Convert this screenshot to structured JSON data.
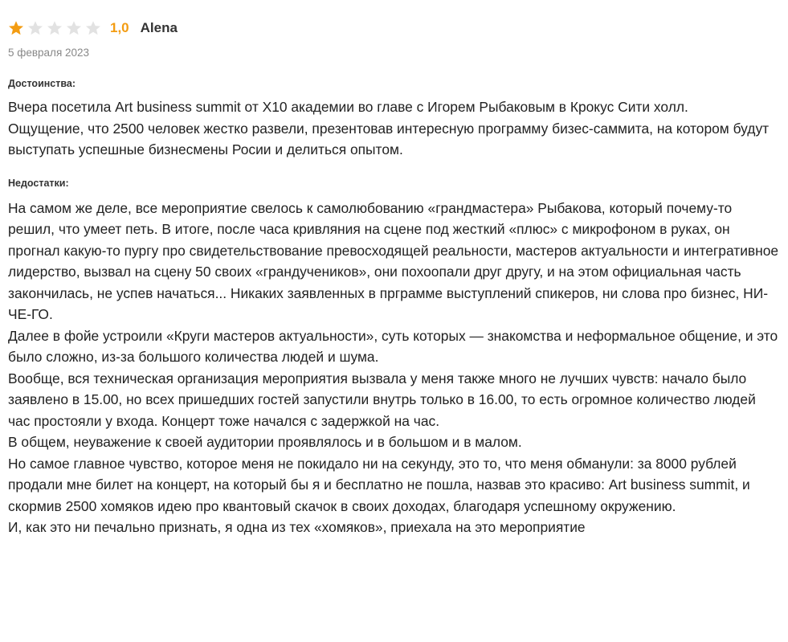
{
  "review": {
    "rating": {
      "value_label": "1,0",
      "filled_stars": 1,
      "total_stars": 5,
      "colors": {
        "filled": "#f39c12",
        "empty": "#e2e2e2"
      }
    },
    "author": "Alena",
    "date": "5 февраля 2023",
    "pros": {
      "title": "Достоинства:",
      "text": "Вчера посетила Art business summit от X10 академии во главе с Игорем Рыбаковым в Крокус Сити холл.\nОщущение, что 2500 человек жестко развели, презентовав интересную программу бизес-саммита, на котором будут выступать успешные бизнесмены Росии и делиться опытом."
    },
    "cons": {
      "title": "Недостатки:",
      "text": "На самом же деле, все мероприятие свелось к самолюбованию «грандмастера» Рыбакова, который почему-то решил, что умеет петь. В итоге, после часа кривляния на сцене под жесткий «плюс» с микрофоном в руках, он прогнал какую-то пургу про свидетельствование превосходящей реальности, мастеров актуальности и интегративное лидерство, вызвал на сцену 50 своих «грандучеников», они похоопали друг другу, и на этом официальная часть закончилась, не успев начаться... Никаких заявленных в прграмме выступлений спикеров, ни слова про бизнес, НИ-ЧЕ-ГО.\nДалее в фойе устроили «Круги мастеров актуальности», суть которых — знакомства и неформальное общение, и это было сложно, из-за большого количества людей и шума.\nВообще, вся техническая организация мероприятия вызвала у меня также много не лучших чувств: начало было заявлено в 15.00, но всех пришедших гостей запустили внутрь только в 16.00, то есть огромное количество людей час простояли у входа. Концерт тоже начался с задержкой на час.\nВ общем, неуважение к своей аудитории проявлялось и в большом и в малом.\nНо самое главное чувство, которое меня не покидало ни на секунду, это то, что меня обманули: за 8000 рублей продали мне билет на концерт, на который бы я и бесплатно не пошла, назвав это красиво: Art business summit, и скормив 2500 хомяков идею про квантовый скачок в своих доходах, благодаря успешному окружению.\nИ, как это ни печально признать, я одна из тех «хомяков», приехала на это мероприятие"
    }
  }
}
